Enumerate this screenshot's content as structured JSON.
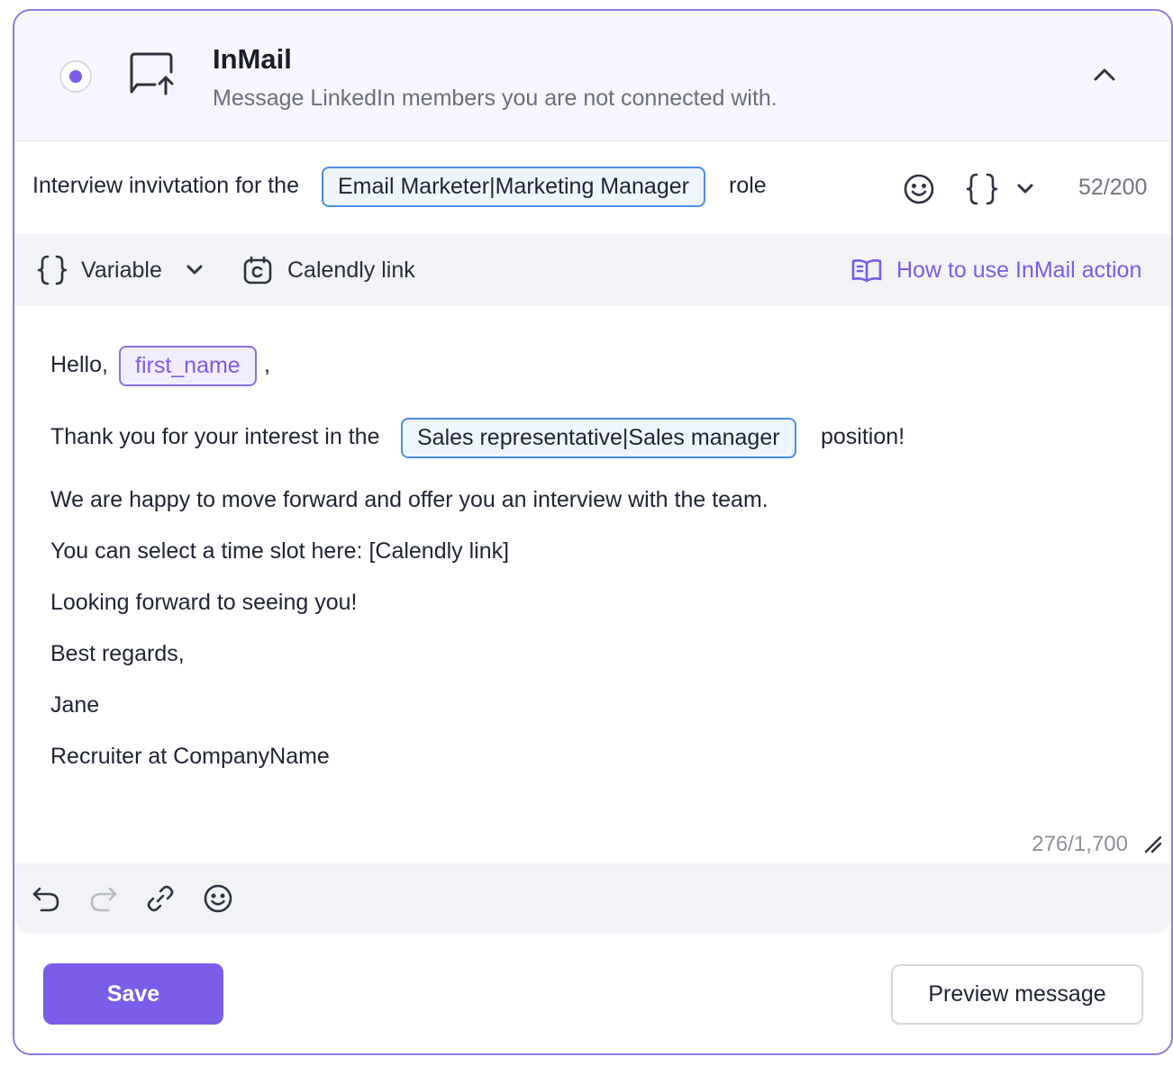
{
  "header": {
    "title": "InMail",
    "subtitle": "Message LinkedIn members you are not connected with."
  },
  "subject": {
    "prefix": "Interview invivtation for the",
    "role_variable": "Email Marketer|Marketing Manager",
    "suffix": "role",
    "counter": "52/200"
  },
  "toolbar": {
    "variable_label": "Variable",
    "calendly_label": "Calendly link",
    "help_link": "How to use InMail action"
  },
  "message": {
    "greeting": "Hello,",
    "first_name_variable": "first_name",
    "greeting_comma": ",",
    "line2_prefix": "Thank you for your interest in the",
    "position_variable": "Sales representative|Sales manager",
    "line2_suffix": "position!",
    "line3": "We are happy to move forward and offer you an interview with the team.",
    "line4": "You can select a time slot here: [Calendly link]",
    "line5": "Looking forward to seeing you!",
    "line6": "Best regards,",
    "line7": "Jane",
    "line8": "Recruiter at CompanyName",
    "counter": "276/1,700"
  },
  "footer": {
    "save_label": "Save",
    "preview_label": "Preview message"
  },
  "colors": {
    "accent": "#7b5ce8",
    "variable_border": "#4a8fe7",
    "header_bg": "#f7f6fe",
    "toolbar_bg": "#f2f3f7"
  }
}
